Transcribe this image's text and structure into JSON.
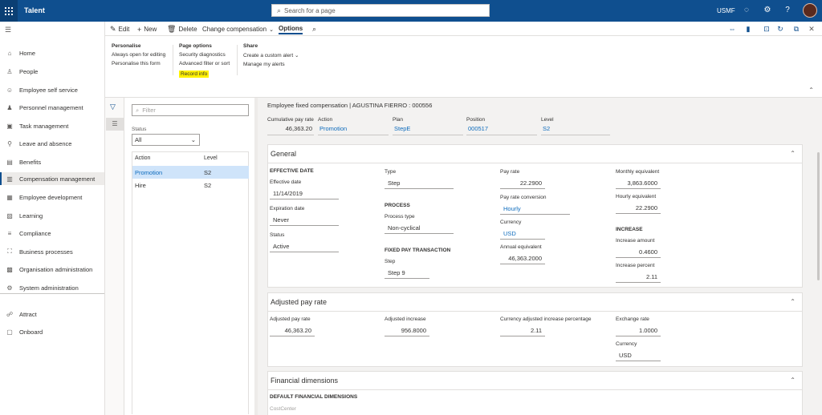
{
  "topbar": {
    "app_name": "Talent",
    "search_placeholder": "Search for a page",
    "company": "USMF"
  },
  "sidebar": {
    "items": [
      {
        "label": "Home",
        "icon": "home-icon"
      },
      {
        "label": "People",
        "icon": "people-icon"
      },
      {
        "label": "Employee self service",
        "icon": "person-icon"
      },
      {
        "label": "Personnel management",
        "icon": "person-gear-icon"
      },
      {
        "label": "Task management",
        "icon": "task-icon"
      },
      {
        "label": "Leave and absence",
        "icon": "leave-icon"
      },
      {
        "label": "Benefits",
        "icon": "benefits-icon"
      },
      {
        "label": "Compensation management",
        "icon": "compensation-icon"
      },
      {
        "label": "Employee development",
        "icon": "development-icon"
      },
      {
        "label": "Learning",
        "icon": "learning-icon"
      },
      {
        "label": "Compliance",
        "icon": "compliance-icon"
      },
      {
        "label": "Business processes",
        "icon": "process-icon"
      },
      {
        "label": "Organisation administration",
        "icon": "org-icon"
      },
      {
        "label": "System administration",
        "icon": "system-icon"
      },
      {
        "label": "Attract",
        "icon": "attract-icon"
      },
      {
        "label": "Onboard",
        "icon": "onboard-icon"
      }
    ]
  },
  "toolbar": {
    "edit": "Edit",
    "new": "New",
    "delete": "Delete",
    "change_compensation": "Change compensation",
    "options": "Options"
  },
  "ribbon": {
    "personalise": {
      "title": "Personalise",
      "items": [
        "Always open for editing",
        "Personalise this form"
      ]
    },
    "page_options": {
      "title": "Page options",
      "items": [
        "Security diagnostics",
        "Advanced filter or sort",
        "Record info"
      ]
    },
    "share": {
      "title": "Share",
      "items": [
        "Create a custom alert",
        "Manage my alerts"
      ]
    }
  },
  "list": {
    "filter_placeholder": "Filter",
    "status_label": "Status",
    "status_value": "All",
    "col_action": "Action",
    "col_level": "Level",
    "rows": [
      {
        "action": "Promotion",
        "level": "S2"
      },
      {
        "action": "Hire",
        "level": "S2"
      }
    ]
  },
  "header": {
    "title": "Employee fixed compensation  |  AGUSTINA FIERRO : 000556",
    "fields": [
      {
        "label": "Cumulative pay rate",
        "value": "46,363.20"
      },
      {
        "label": "Action",
        "value": "Promotion"
      },
      {
        "label": "Plan",
        "value": "StepE"
      },
      {
        "label": "Position",
        "value": "000517"
      },
      {
        "label": "Level",
        "value": "S2"
      }
    ]
  },
  "general": {
    "title": "General",
    "effective_date_header": "EFFECTIVE DATE",
    "effective_date_label": "Effective date",
    "effective_date": "11/14/2019",
    "expiration_date_label": "Expiration date",
    "expiration_date": "Never",
    "status_label": "Status",
    "status": "Active",
    "type_label": "Type",
    "type": "Step",
    "process_header": "PROCESS",
    "process_type_label": "Process type",
    "process_type": "Non-cyclical",
    "fixed_pay_header": "FIXED PAY TRANSACTION",
    "step_label": "Step",
    "step": "Step 9",
    "pay_rate_label": "Pay rate",
    "pay_rate": "22.2900",
    "pay_rate_conversion_label": "Pay rate conversion",
    "pay_rate_conversion": "Hourly",
    "currency_label": "Currency",
    "currency": "USD",
    "annual_equivalent_label": "Annual equivalent",
    "annual_equivalent": "46,363.2000",
    "monthly_equivalent_label": "Monthly equivalent",
    "monthly_equivalent": "3,863.6000",
    "hourly_equivalent_label": "Hourly equivalent",
    "hourly_equivalent": "22.2900",
    "increase_header": "INCREASE",
    "increase_amount_label": "Increase amount",
    "increase_amount": "0.4600",
    "increase_percent_label": "Increase percent",
    "increase_percent": "2.11"
  },
  "adjusted": {
    "title": "Adjusted pay rate",
    "adjusted_pay_rate_label": "Adjusted pay rate",
    "adjusted_pay_rate": "46,363.20",
    "adjusted_increase_label": "Adjusted increase",
    "adjusted_increase": "956.8000",
    "currency_adjusted_label": "Currency adjusted increase percentage",
    "currency_adjusted": "2.11",
    "exchange_rate_label": "Exchange rate",
    "exchange_rate": "1.0000",
    "currency_label": "Currency",
    "currency": "USD"
  },
  "financial": {
    "title": "Financial dimensions",
    "header": "DEFAULT FINANCIAL DIMENSIONS",
    "cost_center_label": "CostCenter"
  },
  "colors": {
    "topbar": "#0f4f8f",
    "highlight": "#fff100",
    "link": "#0f6cbd",
    "selected_row": "#cfe4fa"
  }
}
